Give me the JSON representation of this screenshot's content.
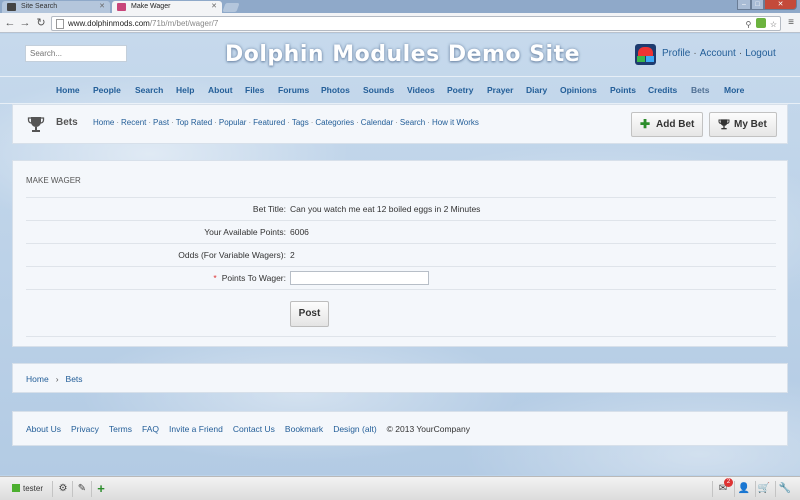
{
  "browser": {
    "tabs": [
      {
        "label": "Site Search",
        "active": false
      },
      {
        "label": "Make Wager",
        "active": true
      }
    ],
    "url_host": "www.dolphinmods.com",
    "url_path": "/71b/m/bet/wager/7"
  },
  "header": {
    "search_placeholder": "Search...",
    "site_title": "Dolphin Modules Demo Site",
    "user_links": [
      "Profile",
      "Account",
      "Logout"
    ]
  },
  "main_nav": [
    "Home",
    "People",
    "Search",
    "Help",
    "About",
    "Files",
    "Forums",
    "Photos",
    "Sounds",
    "Videos",
    "Poetry",
    "Prayer",
    "Diary",
    "Opinions",
    "Points",
    "Credits",
    "Bets",
    "More"
  ],
  "bets_menu": {
    "title": "Bets",
    "links": [
      "Home",
      "Recent",
      "Past",
      "Top Rated",
      "Popular",
      "Featured",
      "Tags",
      "Categories",
      "Calendar",
      "Search",
      "How it Works"
    ],
    "add_bet_label": "Add Bet",
    "my_bet_label": "My Bet"
  },
  "wager_form": {
    "heading": "MAKE WAGER",
    "rows": [
      {
        "label": "Bet Title:",
        "value": "Can you watch me eat 12 boiled eggs in 2 Minutes"
      },
      {
        "label": "Your Available Points:",
        "value": "6006"
      },
      {
        "label": "Odds (For Variable Wagers):",
        "value": "2"
      }
    ],
    "points_label": "Points To Wager:",
    "required_mark": "*",
    "points_value": "",
    "submit_label": "Post"
  },
  "breadcrumb": {
    "items": [
      "Home",
      "Bets"
    ],
    "separator": "›"
  },
  "footer": {
    "links": [
      "About Us",
      "Privacy",
      "Terms",
      "FAQ",
      "Invite a Friend",
      "Contact Us",
      "Bookmark",
      "Design (alt)"
    ],
    "copyright": "© 2013 YourCompany"
  },
  "toolbar": {
    "username": "tester",
    "mail_count": "2"
  },
  "colors": {
    "link": "#235e98",
    "accent_green": "#2b8c2b",
    "background": "#bcd3ea"
  }
}
